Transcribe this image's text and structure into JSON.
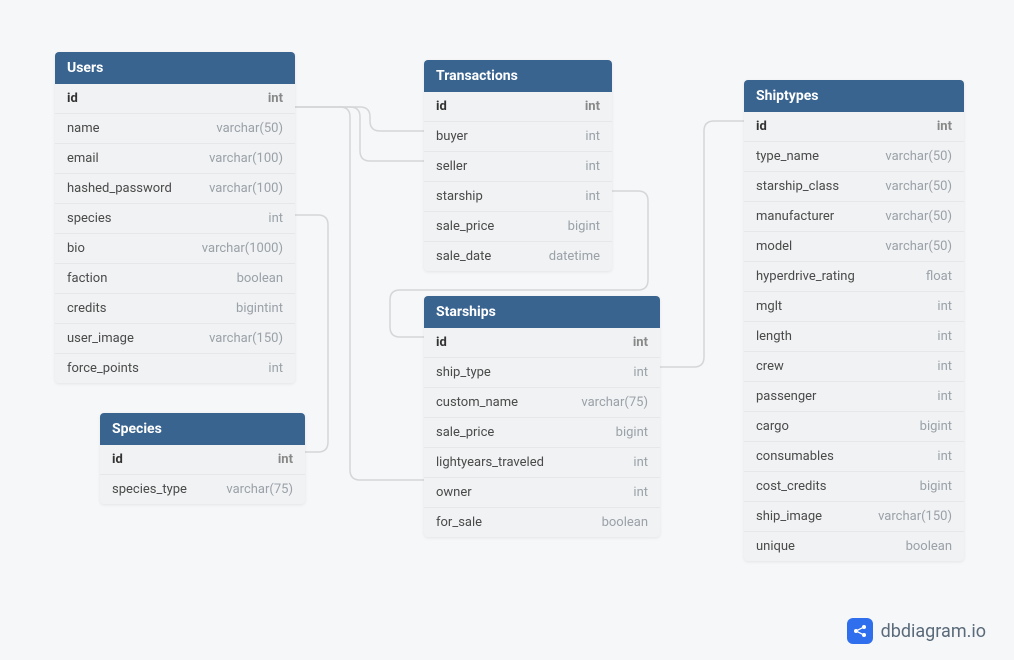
{
  "watermark": {
    "text": "dbdiagram.io"
  },
  "tables": {
    "users": {
      "title": "Users",
      "rows": [
        {
          "name": "id",
          "type": "int",
          "bold": true
        },
        {
          "name": "name",
          "type": "varchar(50)"
        },
        {
          "name": "email",
          "type": "varchar(100)"
        },
        {
          "name": "hashed_password",
          "type": "varchar(100)"
        },
        {
          "name": "species",
          "type": "int"
        },
        {
          "name": "bio",
          "type": "varchar(1000)"
        },
        {
          "name": "faction",
          "type": "boolean"
        },
        {
          "name": "credits",
          "type": "bigintint"
        },
        {
          "name": "user_image",
          "type": "varchar(150)"
        },
        {
          "name": "force_points",
          "type": "int"
        }
      ]
    },
    "species": {
      "title": "Species",
      "rows": [
        {
          "name": "id",
          "type": "int",
          "bold": true
        },
        {
          "name": "species_type",
          "type": "varchar(75)"
        }
      ]
    },
    "transactions": {
      "title": "Transactions",
      "rows": [
        {
          "name": "id",
          "type": "int",
          "bold": true
        },
        {
          "name": "buyer",
          "type": "int"
        },
        {
          "name": "seller",
          "type": "int"
        },
        {
          "name": "starship",
          "type": "int"
        },
        {
          "name": "sale_price",
          "type": "bigint"
        },
        {
          "name": "sale_date",
          "type": "datetime"
        }
      ]
    },
    "starships": {
      "title": "Starships",
      "rows": [
        {
          "name": "id",
          "type": "int",
          "bold": true
        },
        {
          "name": "ship_type",
          "type": "int"
        },
        {
          "name": "custom_name",
          "type": "varchar(75)"
        },
        {
          "name": "sale_price",
          "type": "bigint"
        },
        {
          "name": "lightyears_traveled",
          "type": "int"
        },
        {
          "name": "owner",
          "type": "int"
        },
        {
          "name": "for_sale",
          "type": "boolean"
        }
      ]
    },
    "shiptypes": {
      "title": "Shiptypes",
      "rows": [
        {
          "name": "id",
          "type": "int",
          "bold": true
        },
        {
          "name": "type_name",
          "type": "varchar(50)"
        },
        {
          "name": "starship_class",
          "type": "varchar(50)"
        },
        {
          "name": "manufacturer",
          "type": "varchar(50)"
        },
        {
          "name": "model",
          "type": "varchar(50)"
        },
        {
          "name": "hyperdrive_rating",
          "type": "float"
        },
        {
          "name": "mglt",
          "type": "int"
        },
        {
          "name": "length",
          "type": "int"
        },
        {
          "name": "crew",
          "type": "int"
        },
        {
          "name": "passenger",
          "type": "int"
        },
        {
          "name": "cargo",
          "type": "bigint"
        },
        {
          "name": "consumables",
          "type": "int"
        },
        {
          "name": "cost_credits",
          "type": "bigint"
        },
        {
          "name": "ship_image",
          "type": "varchar(150)"
        },
        {
          "name": "unique",
          "type": "boolean"
        }
      ]
    }
  }
}
